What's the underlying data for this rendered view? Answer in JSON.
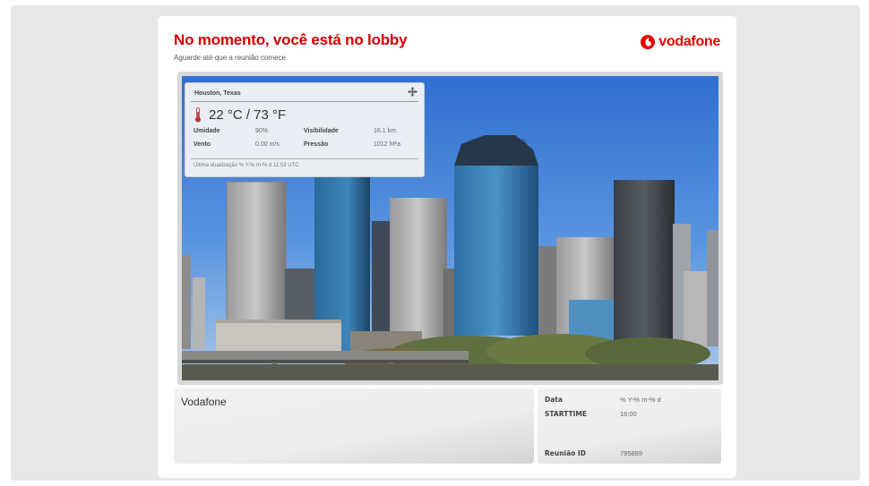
{
  "lobby": {
    "title": "No momento, você está no lobby",
    "subtitle": "Aguarde até que a reunião comece."
  },
  "brand": {
    "name": "vodafone",
    "color": "#e60000"
  },
  "weather": {
    "city": "Houston, Texas",
    "temperature": "22 °C / 73 °F",
    "humidity_label": "Umidade",
    "humidity_value": "90%",
    "visibility_label": "Visibilidade",
    "visibility_value": "16.1 km",
    "wind_label": "Vento",
    "wind_value": "0.00 m/s",
    "pressure_label": "Pressão",
    "pressure_value": "1012 hPa",
    "footer": "Última atualização % Y-% m-% d 11:53 UTC"
  },
  "meeting": {
    "organizer": "Vodafone",
    "date_label": "Data",
    "date_value": "% Y-% m-% d",
    "start_label": "STARTTIME",
    "start_value": "16:00",
    "id_label": "Reunião ID",
    "id_value": "795889"
  },
  "icons": {
    "move": "move-icon",
    "thermometer": "thermometer-icon",
    "brand": "vodafone-logo-icon"
  }
}
